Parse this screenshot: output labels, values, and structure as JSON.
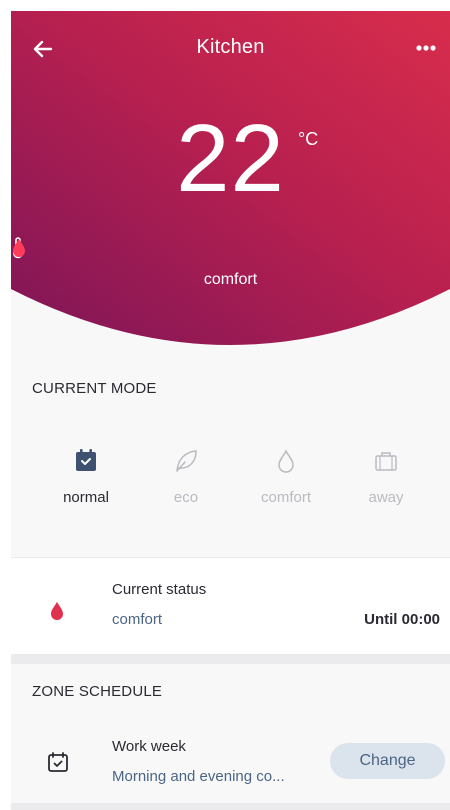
{
  "header": {
    "title": "Kitchen",
    "back_icon": "arrow-left-icon",
    "more_icon": "more-horizontal-icon"
  },
  "thermostat": {
    "temperature": "22",
    "unit": "°C",
    "mode": "comfort",
    "icons": [
      "thermometer-icon",
      "flame-icon"
    ]
  },
  "current_mode": {
    "title": "CURRENT MODE",
    "options": [
      {
        "label": "normal",
        "icon": "calendar-icon",
        "active": true
      },
      {
        "label": "eco",
        "icon": "leaf-icon",
        "active": false
      },
      {
        "label": "comfort",
        "icon": "flame-icon",
        "active": false
      },
      {
        "label": "away",
        "icon": "suitcase-icon",
        "active": false
      }
    ]
  },
  "status": {
    "title": "Current status",
    "value": "comfort",
    "until": "Until 00:00",
    "icon": "flame-icon"
  },
  "zone_schedule": {
    "title": "ZONE SCHEDULE",
    "item_title": "Work week",
    "item_subtitle": "Morning and evening co...",
    "button_label": "Change",
    "icon": "calendar-icon"
  },
  "colors": {
    "hero_gradient_start": "#8c1a5a",
    "hero_gradient_end": "#d62a4e",
    "accent_red": "#e0314f",
    "muted_blue": "#4b6584",
    "button_bg": "#dbe3ec"
  }
}
